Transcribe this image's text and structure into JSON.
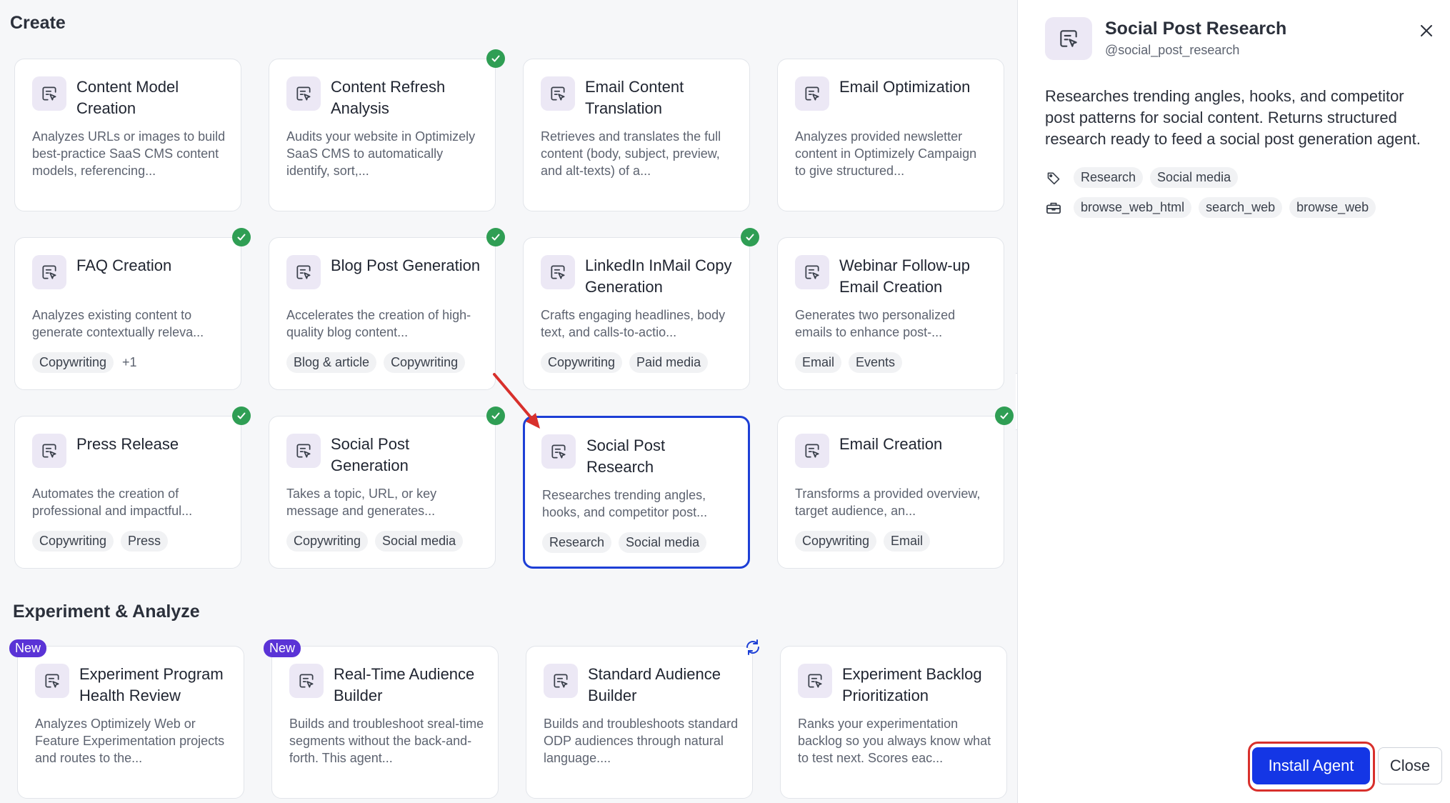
{
  "sections": {
    "create": "Create",
    "experiment": "Experiment & Analyze"
  },
  "create_cards": [
    {
      "title": "Content Model Creation",
      "desc": "Analyzes URLs or images to build best-practice SaaS CMS content models, referencing...",
      "tags": [],
      "installed": false
    },
    {
      "title": "Content Refresh Analysis",
      "desc": "Audits your website in Optimizely SaaS CMS to automatically identify, sort,...",
      "tags": [],
      "installed": true
    },
    {
      "title": "Email Content Translation",
      "desc": "Retrieves and translates the full content (body, subject, preview, and alt-texts) of a...",
      "tags": [],
      "installed": false
    },
    {
      "title": "Email Optimization",
      "desc": "Analyzes provided newsletter content in Optimizely Campaign to give structured...",
      "tags": [],
      "installed": false
    },
    {
      "title": "FAQ Creation",
      "desc": "Analyzes existing content to generate contextually releva...",
      "tags": [
        "Copywriting"
      ],
      "extra": "+1",
      "installed": true
    },
    {
      "title": "Blog Post Generation",
      "desc": "Accelerates the creation of high-quality blog content...",
      "tags": [
        "Blog & article",
        "Copywriting"
      ],
      "installed": true
    },
    {
      "title": "LinkedIn InMail Copy Generation",
      "desc": "Crafts engaging headlines, body text, and calls-to-actio...",
      "tags": [
        "Copywriting",
        "Paid media"
      ],
      "installed": true
    },
    {
      "title": "Webinar Follow-up Email Creation",
      "desc": "Generates two personalized emails to enhance post-...",
      "tags": [
        "Email",
        "Events"
      ],
      "installed": false
    },
    {
      "title": "Press Release",
      "desc": "Automates the creation of professional and impactful...",
      "tags": [
        "Copywriting",
        "Press"
      ],
      "installed": true
    },
    {
      "title": "Social Post Generation",
      "desc": "Takes a topic, URL, or key message and generates...",
      "tags": [
        "Copywriting",
        "Social media"
      ],
      "installed": true
    },
    {
      "title": "Social Post Research",
      "desc": "Researches trending angles, hooks, and competitor post...",
      "tags": [
        "Research",
        "Social media"
      ],
      "installed": false
    },
    {
      "title": "Email Creation",
      "desc": "Transforms a provided overview, target audience, an...",
      "tags": [
        "Copywriting",
        "Email"
      ],
      "installed": true
    }
  ],
  "experiment_cards": [
    {
      "title": "Experiment Program Health Review",
      "desc": "Analyzes Optimizely Web or Feature Experimentation projects and routes to the...",
      "badge": "New"
    },
    {
      "title": "Real-Time Audience Builder",
      "desc": "Builds and troubleshoot sreal-time segments without the back-and-forth. This agent...",
      "badge": "New"
    },
    {
      "title": "Standard Audience Builder",
      "desc": "Builds and troubleshoots standard ODP audiences through natural language....",
      "badge": ""
    },
    {
      "title": "Experiment Backlog Prioritization",
      "desc": "Ranks your experimentation backlog so you always know what to test next. Scores eac...",
      "badge": ""
    }
  ],
  "panel": {
    "title": "Social Post Research",
    "handle": "@social_post_research",
    "description": "Researches trending angles, hooks, and competitor post patterns for social content. Returns structured research ready to feed a social post generation agent.",
    "tags": [
      "Research",
      "Social media"
    ],
    "tools": [
      "browse_web_html",
      "search_web",
      "browse_web"
    ],
    "install_label": "Install Agent",
    "close_label": "Close"
  },
  "colors": {
    "accent": "#1436e5",
    "selected_border": "#1d3fd6",
    "check": "#2f9e54",
    "new_badge": "#5a33d6",
    "annotation": "#d8302c"
  }
}
